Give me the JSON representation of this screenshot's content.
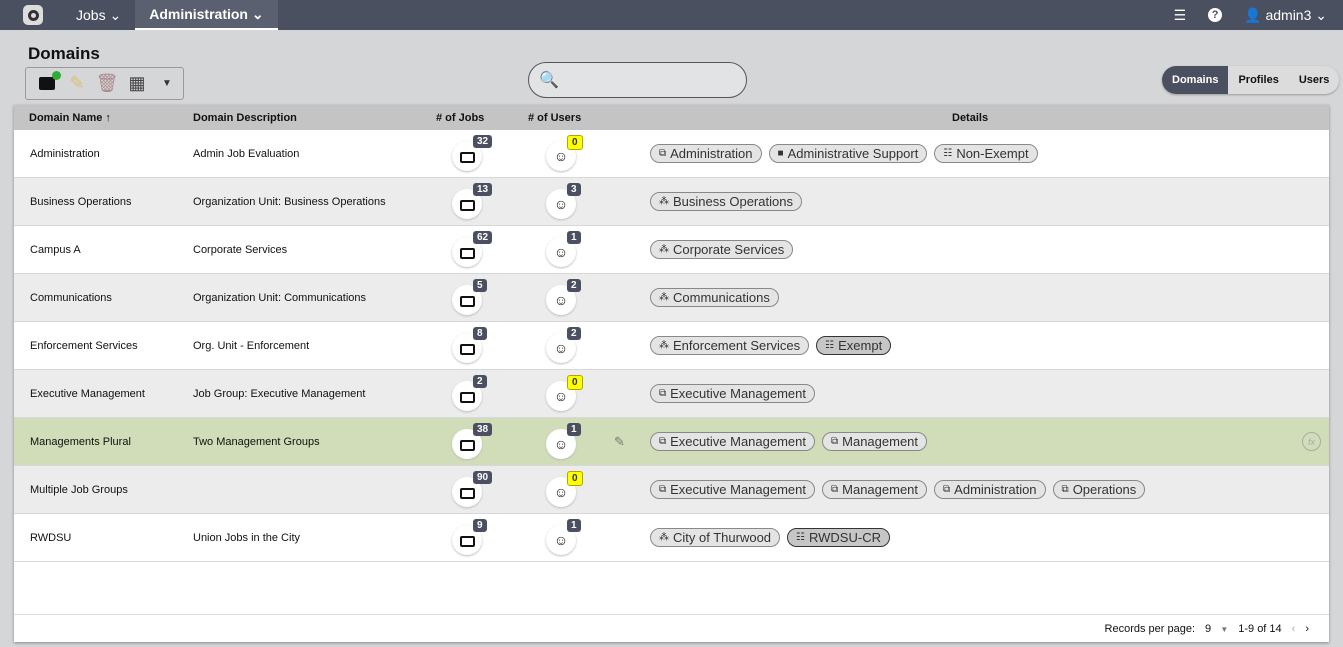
{
  "nav": {
    "jobs": "Jobs",
    "administration": "Administration",
    "user": "admin3"
  },
  "page": {
    "title": "Domains"
  },
  "search": {
    "value": "",
    "placeholder": ""
  },
  "view_toggle": [
    "Domains",
    "Profiles",
    "Users"
  ],
  "columns": {
    "name": "Domain Name",
    "description": "Domain Description",
    "jobs": "# of Jobs",
    "users": "# of Users",
    "details": "Details"
  },
  "rows": [
    {
      "name": "Administration",
      "description": "Admin Job Evaluation",
      "jobs": "32",
      "users": "0",
      "chips": [
        {
          "icon": "job-group",
          "label": "Administration"
        },
        {
          "icon": "briefcase",
          "label": "Administrative Support"
        },
        {
          "icon": "flsa",
          "label": "Non-Exempt"
        }
      ]
    },
    {
      "name": "Business Operations",
      "description": "Organization Unit: Business Operations",
      "jobs": "13",
      "users": "3",
      "chips": [
        {
          "icon": "org-unit",
          "label": "Business Operations"
        }
      ]
    },
    {
      "name": "Campus A",
      "description": "Corporate Services",
      "jobs": "62",
      "users": "1",
      "chips": [
        {
          "icon": "org-unit",
          "label": "Corporate Services"
        }
      ]
    },
    {
      "name": "Communications",
      "description": "Organization Unit: Communications",
      "jobs": "5",
      "users": "2",
      "chips": [
        {
          "icon": "org-unit",
          "label": "Communications"
        }
      ]
    },
    {
      "name": "Enforcement Services",
      "description": "Org. Unit - Enforcement",
      "jobs": "8",
      "users": "2",
      "chips": [
        {
          "icon": "org-unit",
          "label": "Enforcement Services"
        },
        {
          "icon": "flsa",
          "label": "Exempt",
          "dark": true
        }
      ]
    },
    {
      "name": "Executive Management",
      "description": "Job Group: Executive Management",
      "jobs": "2",
      "users": "0",
      "chips": [
        {
          "icon": "job-group",
          "label": "Executive Management"
        }
      ]
    },
    {
      "name": "Managements Plural",
      "description": "Two Management Groups",
      "jobs": "38",
      "users": "1",
      "selected": true,
      "chips": [
        {
          "icon": "job-group",
          "label": "Executive Management"
        },
        {
          "icon": "job-group",
          "label": "Management"
        }
      ]
    },
    {
      "name": "Multiple Job Groups",
      "description": "",
      "jobs": "90",
      "users": "0",
      "chips": [
        {
          "icon": "job-group",
          "label": "Executive Management"
        },
        {
          "icon": "job-group",
          "label": "Management"
        },
        {
          "icon": "job-group",
          "label": "Administration"
        },
        {
          "icon": "job-group",
          "label": "Operations"
        }
      ]
    },
    {
      "name": "RWDSU",
      "description": "Union Jobs in the City",
      "jobs": "9",
      "users": "1",
      "chips": [
        {
          "icon": "org-unit",
          "label": "City of Thurwood"
        },
        {
          "icon": "flsa",
          "label": "RWDSU-CR",
          "dark": true
        }
      ]
    }
  ],
  "footer": {
    "records_label": "Records per page:",
    "per_page": "9",
    "range": "1-9 of 14"
  }
}
